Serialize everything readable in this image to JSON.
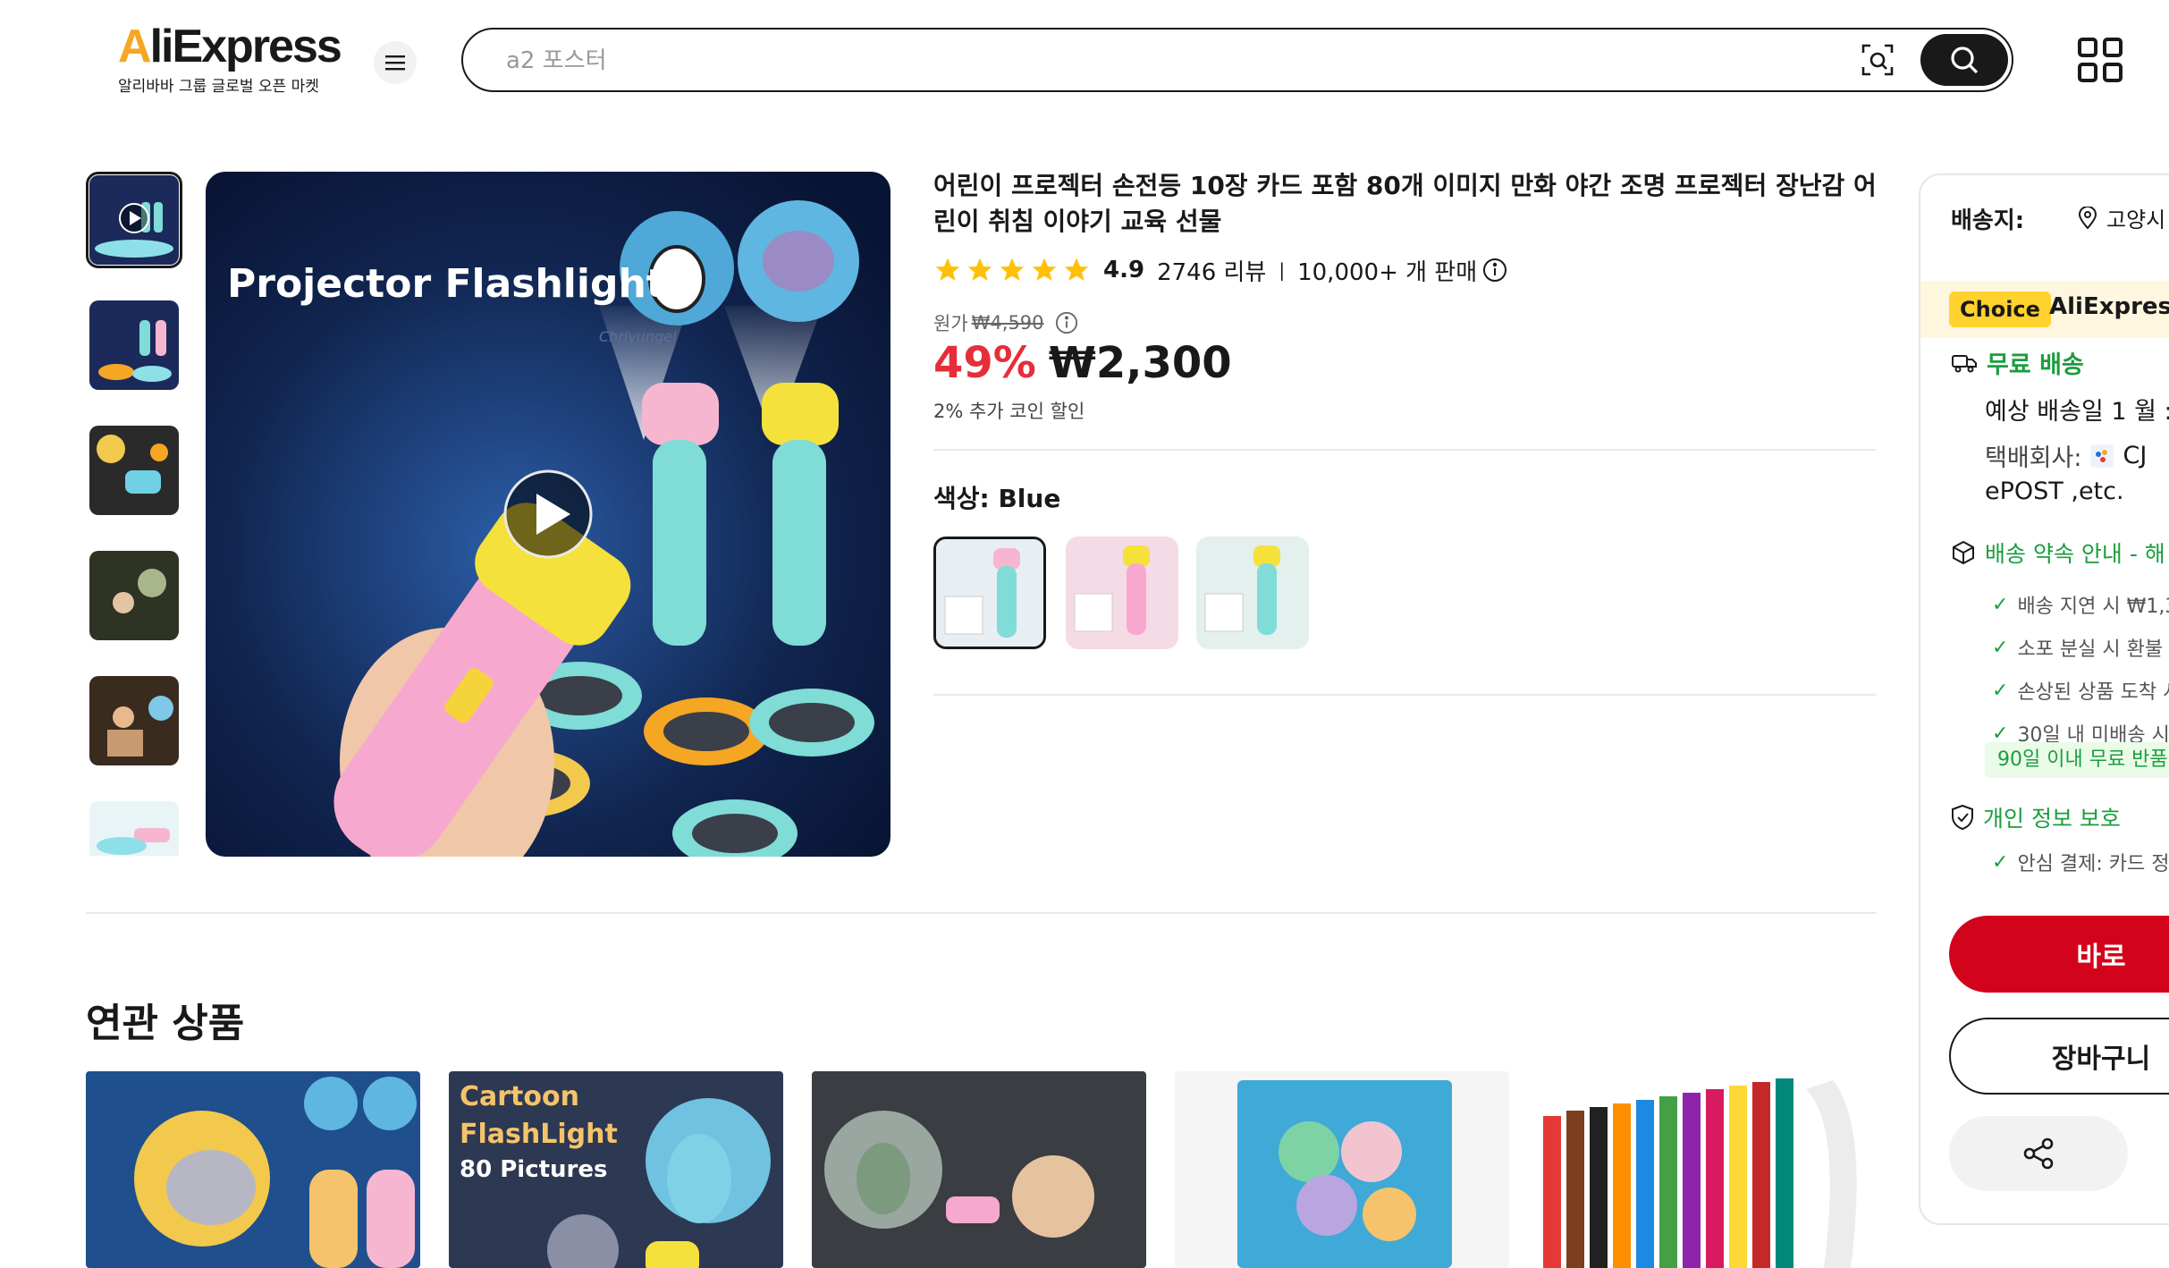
{
  "header": {
    "logo_text": "AliExpress",
    "logo_sub": "알리바바 그룹 글로벌 오픈 마켓",
    "search_placeholder": "a2 포스터"
  },
  "gallery": {
    "main_image_text": "Projector Flashlight",
    "watermark": "Chriyungel"
  },
  "product": {
    "title": "어린이 프로젝터 손전등 10장 카드 포함 80개 이미지 만화 야간 조명 프로젝터 장난감 어린이 취침 이야기 교육 선물",
    "rating": "4.9",
    "reviews": "2746 리뷰",
    "sold": "10,000+ 개 판매",
    "original_label": "원가",
    "original_price": "₩4,590",
    "discount": "49%",
    "price": "₩2,300",
    "coin_discount": "2% 추가 코인 할인",
    "color_label": "색상: Blue"
  },
  "related": {
    "title": "연관 상품",
    "card2_line1": "Cartoon",
    "card2_line2": "FlashLight",
    "card2_line3": "80 Pictures"
  },
  "panel": {
    "ship_to_label": "배송지:",
    "ship_to_location": "고양시",
    "choice_badge": "Choice",
    "choice_name": "AliExpress",
    "free_shipping": "무료 배송",
    "eta": "예상 배송일 1 월 :",
    "carrier_label": "택배회사:",
    "carrier_name": "CJ",
    "carrier_more": "ePOST ,etc.",
    "promise_title": "배송 약속 안내 - 해",
    "guarantee_1": "배송 지연 시 ₩1,3",
    "guarantee_2": "소포 분실 시 환불",
    "guarantee_3": "손상된 상품 도착 시",
    "guarantee_4": "30일 내 미배송 시",
    "free_return": "90일 이내 무료 반품",
    "privacy_title": "개인 정보 보호",
    "privacy_item": "안심 결제: 카드 정",
    "buy_label": "바로",
    "cart_label": "장바구니"
  },
  "colors": {
    "price_red": "#e62e3a",
    "buy_red": "#d3031c",
    "green": "#1a9e3e",
    "star_yellow": "#ffc107",
    "choice_yellow": "#ffd22e"
  }
}
